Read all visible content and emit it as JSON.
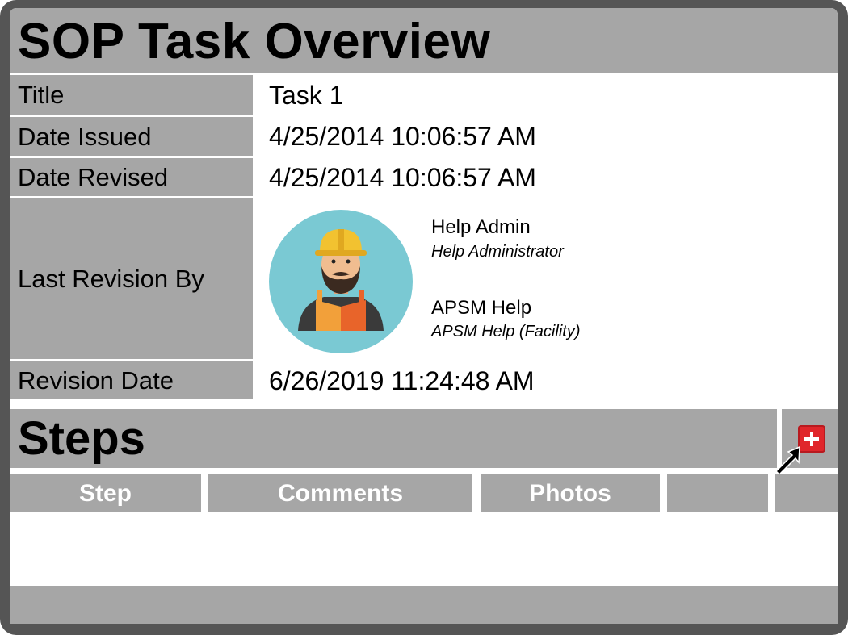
{
  "header": {
    "title": "SOP Task Overview"
  },
  "fields": {
    "title_label": "Title",
    "title_value": "Task 1",
    "date_issued_label": "Date Issued",
    "date_issued_value": "4/25/2014 10:06:57 AM",
    "date_revised_label": "Date Revised",
    "date_revised_value": "4/25/2014 10:06:57 AM",
    "last_revision_label": "Last Revision By",
    "revision_date_label": "Revision Date",
    "revision_date_value": "6/26/2019 11:24:48 AM"
  },
  "revisers": [
    {
      "name": "Help Admin",
      "role": "Help Administrator"
    },
    {
      "name": "APSM Help",
      "role": "APSM Help (Facility)"
    }
  ],
  "steps": {
    "title": "Steps",
    "columns": [
      "Step",
      "Comments",
      "Photos",
      "",
      ""
    ],
    "add_icon": "plus-icon"
  },
  "colors": {
    "frame": "#555555",
    "header_gray": "#a6a6a6",
    "add_red": "#e0262b",
    "avatar_bg": "#7ac9d3"
  }
}
